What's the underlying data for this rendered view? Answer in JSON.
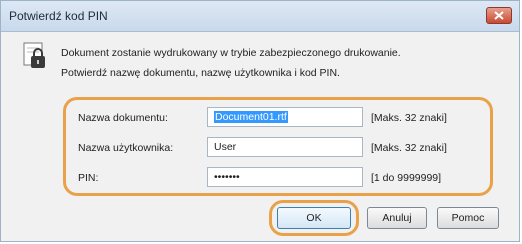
{
  "dialog": {
    "title": "Potwierdź kod PIN",
    "close_icon": "close-icon",
    "message_icon": "document-lock-icon",
    "message_line1": "Dokument zostanie wydrukowany w trybie zabezpieczonego drukowanie.",
    "message_line2": "Potwierdź nazwę dokumentu, nazwę użytkownika i kod PIN.",
    "fields": [
      {
        "label": "Nazwa dokumentu:",
        "value": "Document01.rtf",
        "hint": "[Maks. 32 znaki]"
      },
      {
        "label": "Nazwa użytkownika:",
        "value": "User",
        "hint": "[Maks. 32 znaki]"
      },
      {
        "label": "PIN:",
        "value": "•••••••",
        "hint": "[1 do 9999999]"
      }
    ],
    "buttons": {
      "ok": "OK",
      "cancel": "Anuluj",
      "help": "Pomoc"
    },
    "highlight_color": "#e9a24a"
  }
}
